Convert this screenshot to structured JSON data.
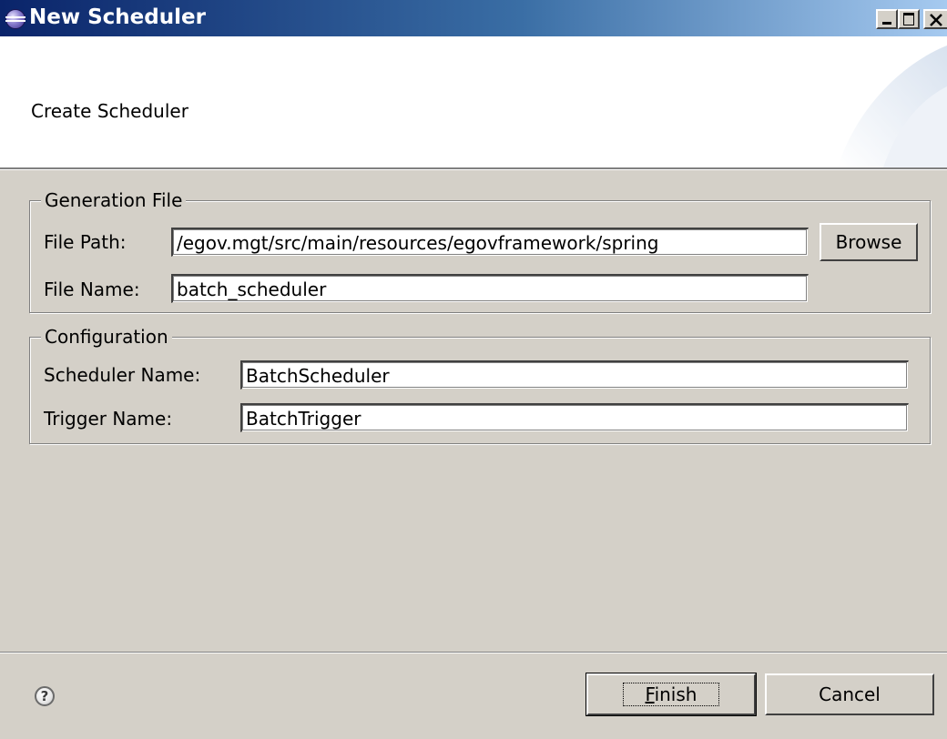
{
  "window": {
    "title": "New Scheduler",
    "controls": {
      "minimize": "minimize-icon",
      "maximize": "maximize-icon",
      "close": "close-icon"
    }
  },
  "banner": {
    "title": "Create Scheduler"
  },
  "generation_file": {
    "legend": "Generation File",
    "file_path_label": "File Path:",
    "file_path_value": "/egov.mgt/src/main/resources/egovframework/spring",
    "browse_label": "Browse",
    "file_name_label": "File Name:",
    "file_name_value": "batch_scheduler"
  },
  "configuration": {
    "legend": "Configuration",
    "scheduler_name_label": "Scheduler Name:",
    "scheduler_name_value": "BatchScheduler",
    "trigger_name_label": "Trigger Name:",
    "trigger_name_value": "BatchTrigger"
  },
  "footer": {
    "help_icon": "help-icon",
    "finish_label": "Finish",
    "finish_mnemonic": "F",
    "finish_rest": "inish",
    "cancel_label": "Cancel"
  },
  "colors": {
    "title_start": "#0a246a",
    "title_end": "#a6caf0",
    "dialog_bg": "#d4d0c8",
    "banner_bg": "#ffffff"
  }
}
